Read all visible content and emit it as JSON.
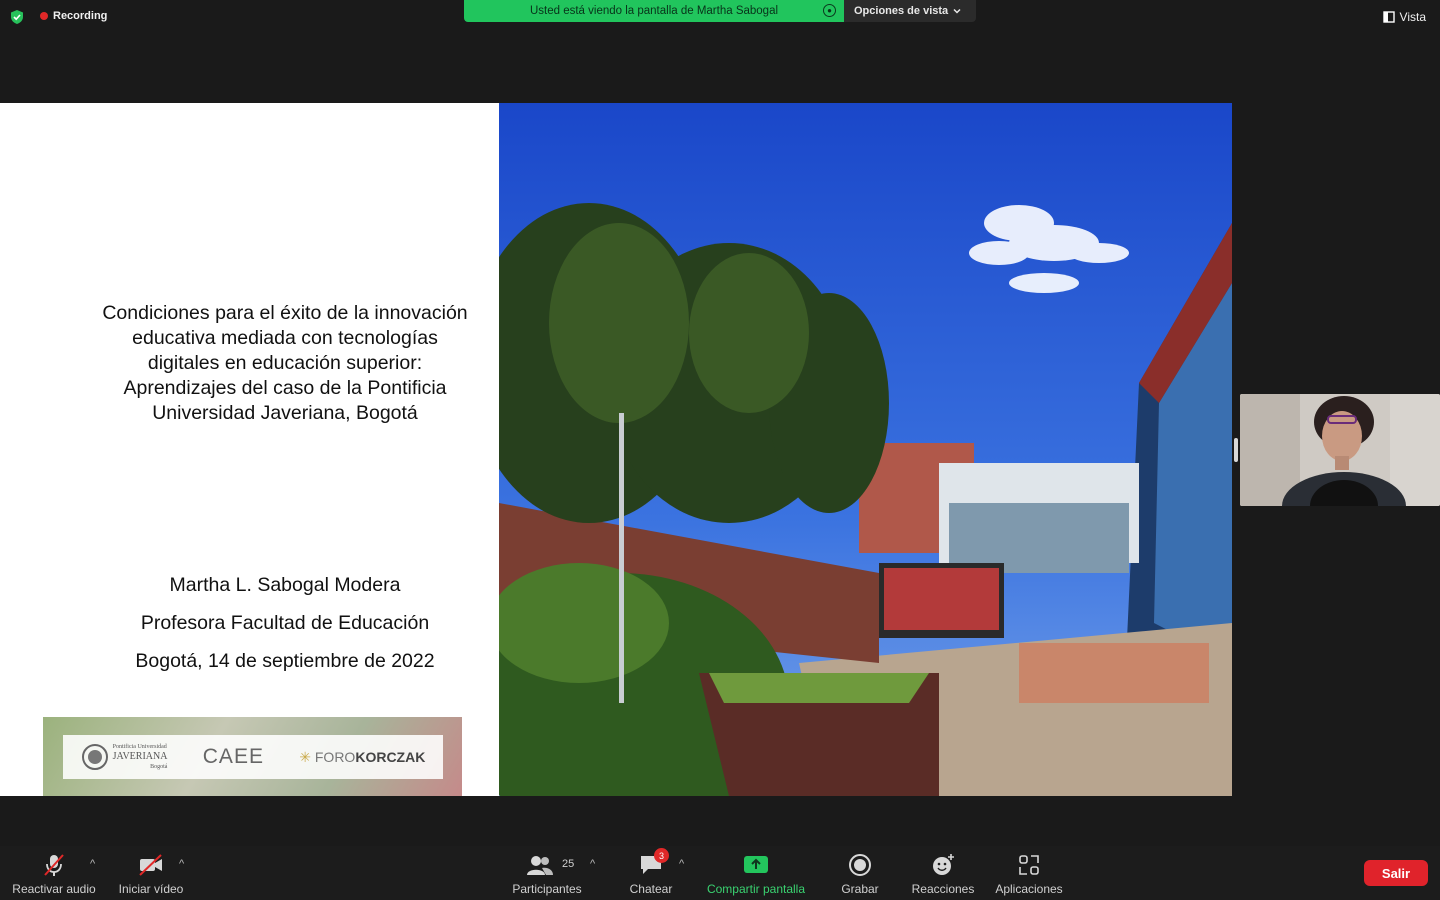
{
  "topbar": {
    "recording_label": "Recording",
    "share_banner": "Usted está viendo la pantalla de Martha Sabogal",
    "view_options": "Opciones de vista",
    "view_button": "Vista"
  },
  "slide": {
    "title_lines": [
      "Condiciones para el éxito de la innovación",
      "educativa mediada con tecnologías",
      "digitales en educación superior:",
      "Aprendizajes del caso de la Pontificia",
      "Universidad Javeriana, Bogotá"
    ],
    "author": "Martha L. Sabogal Modera",
    "role": "Profesora Facultad de Educación",
    "date": "Bogotá, 14 de septiembre de 2022",
    "logos": {
      "javeriana_line1": "Pontificia Universidad",
      "javeriana_line2": "JAVERIANA",
      "javeriana_line3": "Bogotá",
      "caee": "CAEE",
      "foro_prefix": "FORO",
      "foro_suffix": "KORCZAK"
    }
  },
  "toolbar": {
    "audio_label": "Reactivar audio",
    "video_label": "Iniciar vídeo",
    "participants_label": "Participantes",
    "participants_count": "25",
    "chat_label": "Chatear",
    "chat_badge": "3",
    "share_label": "Compartir pantalla",
    "record_label": "Grabar",
    "reactions_label": "Reacciones",
    "apps_label": "Aplicaciones",
    "leave_label": "Salir"
  },
  "colors": {
    "share_green": "#21c55d",
    "leave_red": "#e0232b",
    "badge_red": "#e02828"
  }
}
